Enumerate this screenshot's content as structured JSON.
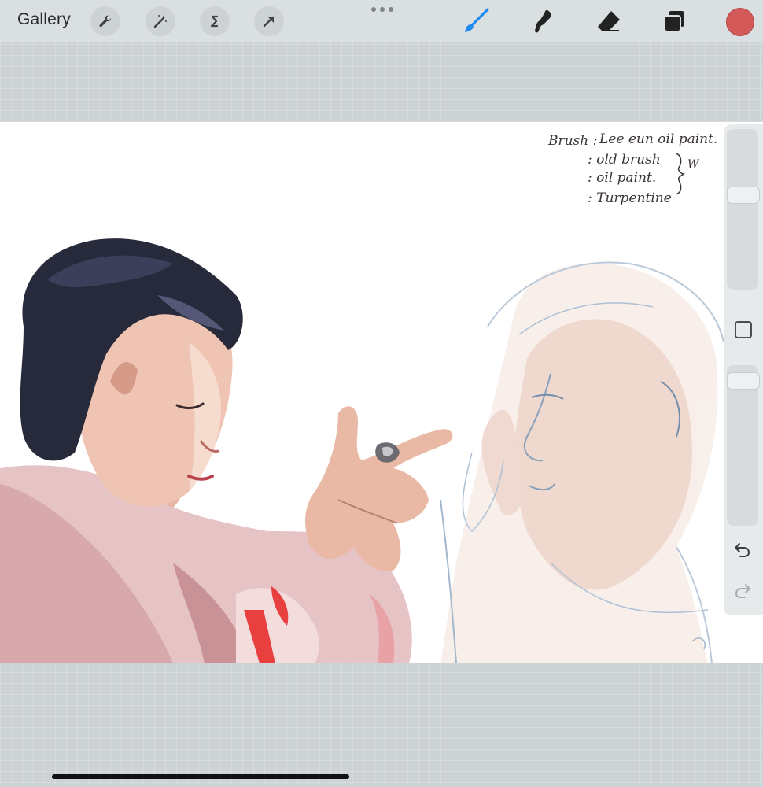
{
  "toolbar": {
    "gallery_label": "Gallery",
    "left_tools": [
      {
        "name": "actions",
        "icon": "wrench-icon"
      },
      {
        "name": "adjustments",
        "icon": "magic-wand-icon"
      },
      {
        "name": "selection",
        "icon": "selection-s-icon"
      },
      {
        "name": "transform",
        "icon": "arrow-cursor-icon"
      }
    ],
    "right_tools": [
      {
        "name": "brush",
        "icon": "brush-icon",
        "active": true
      },
      {
        "name": "smudge",
        "icon": "smudge-icon"
      },
      {
        "name": "eraser",
        "icon": "eraser-icon"
      },
      {
        "name": "layers",
        "icon": "layers-icon"
      }
    ],
    "current_color": "#d45a5a",
    "active_accent": "#1f8bf0"
  },
  "canvas_notes": {
    "line1_prefix": "Brush :",
    "line1_value": "Lee eun oil paint.",
    "line2": ": old brush",
    "line3": ": oil paint.",
    "line4": ": Turpentine",
    "side_mark": "W"
  },
  "sidebar": {
    "brush_size_level": 0.6,
    "opacity_level": 0.95,
    "undo_icon": "undo-icon",
    "redo_icon": "redo-icon"
  }
}
